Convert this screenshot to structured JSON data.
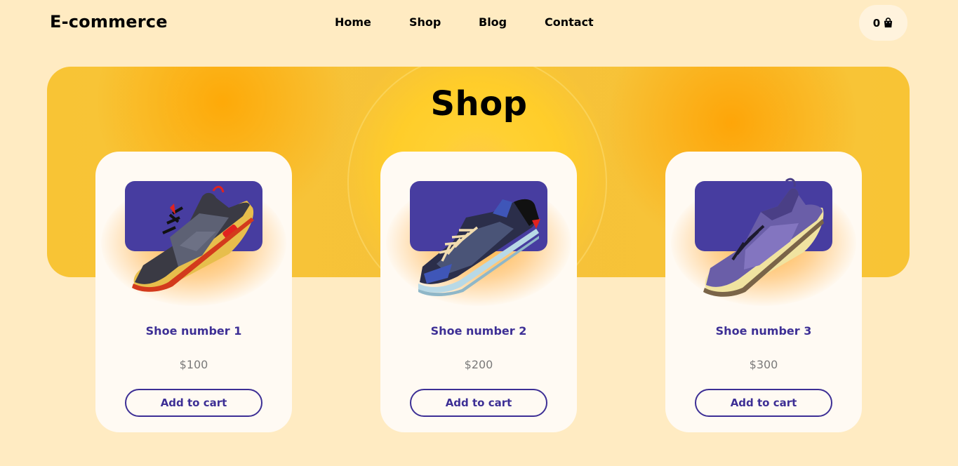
{
  "header": {
    "logo": "E-commerce",
    "nav": [
      "Home",
      "Shop",
      "Blog",
      "Contact"
    ],
    "cart_count": "0"
  },
  "hero": {
    "title": "Shop"
  },
  "products": [
    {
      "name": "Shoe number 1",
      "price": "$100",
      "button": "Add to cart"
    },
    {
      "name": "Shoe number 2",
      "price": "$200",
      "button": "Add to cart"
    },
    {
      "name": "Shoe number 3",
      "price": "$300",
      "button": "Add to cart"
    }
  ],
  "colors": {
    "background": "#ffebc2",
    "accent": "#3d2f95",
    "plate": "#473da0",
    "hero": "#f8c435"
  },
  "icons": {
    "cart": "shopping-bag-icon"
  }
}
